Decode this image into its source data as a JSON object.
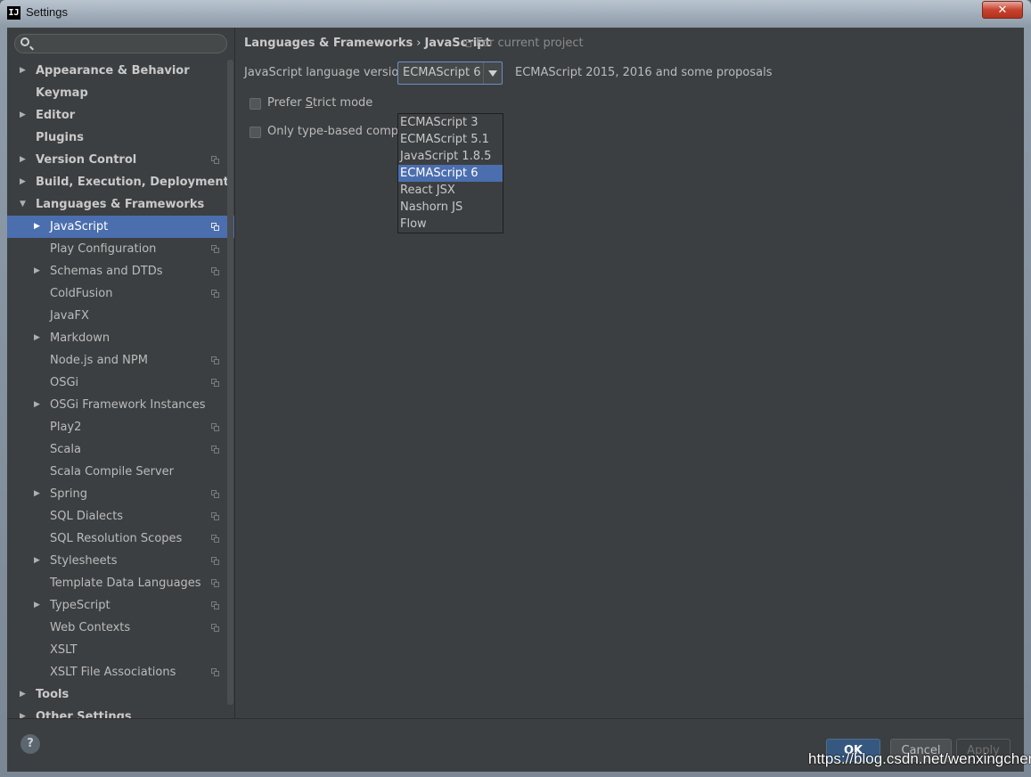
{
  "window": {
    "title": "Settings",
    "logo_text": "IJ",
    "close_glyph": "✕"
  },
  "search": {
    "placeholder": "",
    "value": ""
  },
  "tree": [
    {
      "label": "Appearance & Behavior",
      "level": 0,
      "arrow": true,
      "proj": false
    },
    {
      "label": "Keymap",
      "level": 0,
      "arrow": false,
      "proj": false
    },
    {
      "label": "Editor",
      "level": 0,
      "arrow": true,
      "proj": false
    },
    {
      "label": "Plugins",
      "level": 0,
      "arrow": false,
      "proj": false
    },
    {
      "label": "Version Control",
      "level": 0,
      "arrow": true,
      "proj": true
    },
    {
      "label": "Build, Execution, Deployment",
      "level": 0,
      "arrow": true,
      "proj": false
    },
    {
      "label": "Languages & Frameworks",
      "level": 0,
      "arrow": "open",
      "proj": false
    },
    {
      "label": "JavaScript",
      "level": 1,
      "arrow": true,
      "proj": true,
      "selected": true
    },
    {
      "label": "Play Configuration",
      "level": 1,
      "arrow": false,
      "proj": true
    },
    {
      "label": "Schemas and DTDs",
      "level": 1,
      "arrow": true,
      "proj": true
    },
    {
      "label": "ColdFusion",
      "level": 1,
      "arrow": false,
      "proj": true
    },
    {
      "label": "JavaFX",
      "level": 1,
      "arrow": false,
      "proj": false
    },
    {
      "label": "Markdown",
      "level": 1,
      "arrow": true,
      "proj": false
    },
    {
      "label": "Node.js and NPM",
      "level": 1,
      "arrow": false,
      "proj": true
    },
    {
      "label": "OSGi",
      "level": 1,
      "arrow": false,
      "proj": true
    },
    {
      "label": "OSGi Framework Instances",
      "level": 1,
      "arrow": true,
      "proj": false
    },
    {
      "label": "Play2",
      "level": 1,
      "arrow": false,
      "proj": true
    },
    {
      "label": "Scala",
      "level": 1,
      "arrow": false,
      "proj": true
    },
    {
      "label": "Scala Compile Server",
      "level": 1,
      "arrow": false,
      "proj": false
    },
    {
      "label": "Spring",
      "level": 1,
      "arrow": true,
      "proj": true
    },
    {
      "label": "SQL Dialects",
      "level": 1,
      "arrow": false,
      "proj": true
    },
    {
      "label": "SQL Resolution Scopes",
      "level": 1,
      "arrow": false,
      "proj": true
    },
    {
      "label": "Stylesheets",
      "level": 1,
      "arrow": true,
      "proj": true
    },
    {
      "label": "Template Data Languages",
      "level": 1,
      "arrow": false,
      "proj": true
    },
    {
      "label": "TypeScript",
      "level": 1,
      "arrow": true,
      "proj": true
    },
    {
      "label": "Web Contexts",
      "level": 1,
      "arrow": false,
      "proj": true
    },
    {
      "label": "XSLT",
      "level": 1,
      "arrow": false,
      "proj": false
    },
    {
      "label": "XSLT File Associations",
      "level": 1,
      "arrow": false,
      "proj": true
    },
    {
      "label": "Tools",
      "level": 0,
      "arrow": true,
      "proj": false
    },
    {
      "label": "Other Settings",
      "level": 0,
      "arrow": true,
      "proj": false
    }
  ],
  "breadcrumb": {
    "part1": "Languages & Frameworks",
    "separator": "›",
    "part2": "JavaScript",
    "note": "For current project"
  },
  "language": {
    "label": "JavaScript language version",
    "selected": "ECMAScript 6",
    "description": "ECMAScript 2015, 2016 and some proposals",
    "options": [
      "ECMAScript 3",
      "ECMAScript 5.1",
      "JavaScript 1.8.5",
      "ECMAScript 6",
      "React JSX",
      "Nashorn JS",
      "Flow"
    ],
    "selected_index": 3
  },
  "checkboxes": {
    "strict_before": "Prefer ",
    "strict_mnemonic": "S",
    "strict_after": "trict mode",
    "typebased": "Only type-based complet"
  },
  "footer": {
    "help": "?",
    "ok": "OK",
    "cancel": "Cancel",
    "apply": "Apply"
  },
  "watermark": "https://blog.csdn.net/wenxingchen",
  "colors": {
    "selection": "#4b6eaf",
    "panel": "#3c3f41",
    "ok_button": "#365880"
  }
}
